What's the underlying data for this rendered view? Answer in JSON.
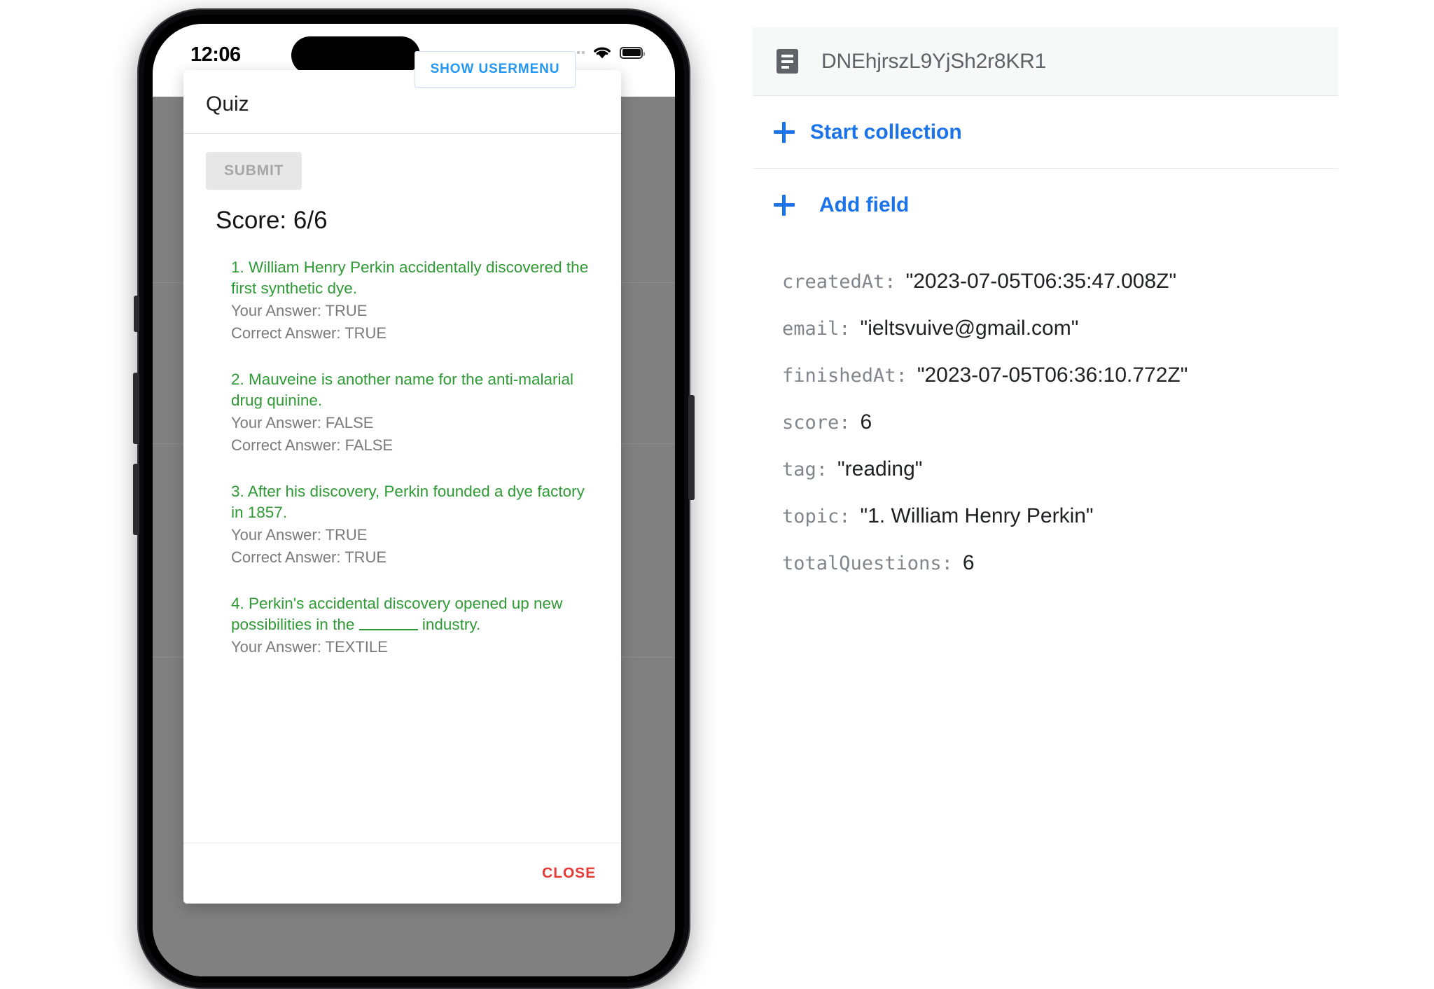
{
  "phone": {
    "status_bar": {
      "time": "12:06",
      "wifi_icon": "wifi-icon",
      "battery_icon": "battery-icon",
      "signal_icon": "signal-dots-icon"
    },
    "show_usermenu_button": "SHOW USERMENU",
    "dialog": {
      "title": "Quiz",
      "submit_button": "SUBMIT",
      "score": "Score: 6/6",
      "close_button": "CLOSE",
      "questions": [
        {
          "text": "1. William Henry Perkin accidentally discovered the first synthetic dye.",
          "your_answer": "Your Answer: TRUE",
          "correct_answer": "Correct Answer: TRUE"
        },
        {
          "text": "2. Mauveine is another name for the anti-malarial drug quinine.",
          "your_answer": "Your Answer: FALSE",
          "correct_answer": "Correct Answer: FALSE"
        },
        {
          "text": "3. After his discovery, Perkin founded a dye factory in 1857.",
          "your_answer": "Your Answer: TRUE",
          "correct_answer": "Correct Answer: TRUE"
        },
        {
          "text_before_blank": "4. Perkin's accidental discovery opened up new possibilities in the ",
          "text_after_blank": " industry.",
          "your_answer": "Your Answer: TEXTILE",
          "correct_answer": ""
        }
      ]
    }
  },
  "firestore": {
    "document_id": "DNEhjrszL9YjSh2r8KR1",
    "document_icon": "document-icon",
    "start_collection_label": "Start collection",
    "add_field_label": "Add field",
    "fields": [
      {
        "key": "createdAt:",
        "value": "\"2023-07-05T06:35:47.008Z\""
      },
      {
        "key": "email:",
        "value": "\"ieltsvuive@gmail.com\""
      },
      {
        "key": "finishedAt:",
        "value": "\"2023-07-05T06:36:10.772Z\""
      },
      {
        "key": "score:",
        "value": "6"
      },
      {
        "key": "tag:",
        "value": "\"reading\""
      },
      {
        "key": "topic:",
        "value": "\"1. William Henry Perkin\""
      },
      {
        "key": "totalQuestions:",
        "value": "6"
      }
    ]
  },
  "colors": {
    "accent_blue": "#1a73e8",
    "button_blue": "#2196f3",
    "correct_green": "#2e9b34",
    "close_red": "#e53935",
    "scrim_gray": "#808080"
  }
}
